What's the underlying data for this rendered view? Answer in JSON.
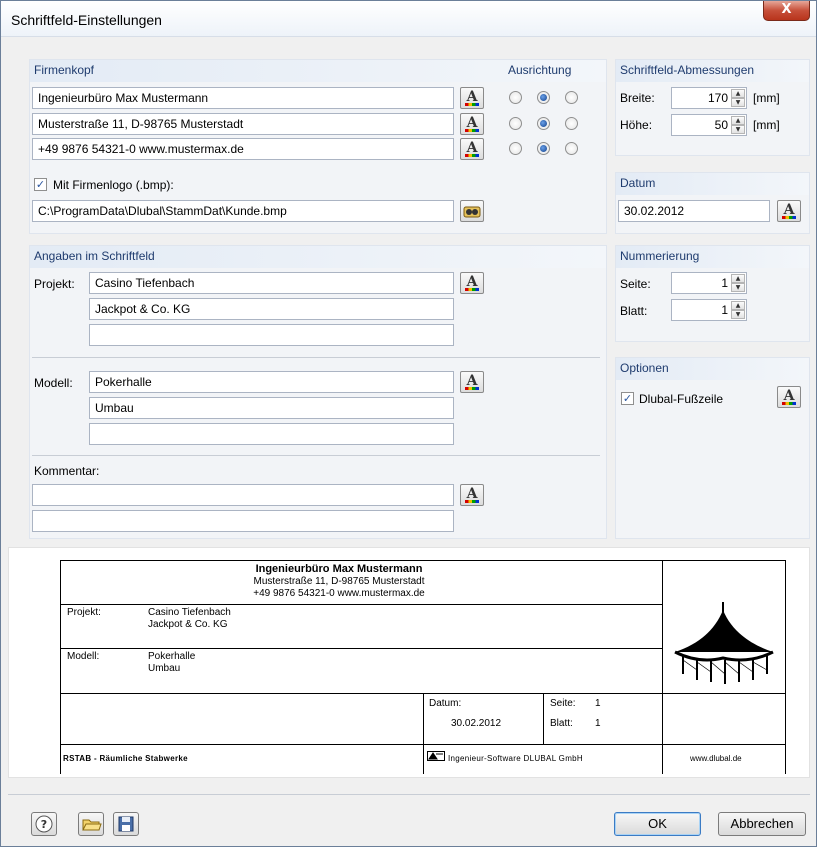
{
  "window": {
    "title": "Schriftfeld-Einstellungen",
    "close_glyph": "X"
  },
  "firmenkopf": {
    "header": "Firmenkopf",
    "ausrichtung_header": "Ausrichtung",
    "lines": [
      "Ingenieurbüro Max Mustermann",
      "Musterstraße 11, D-98765 Musterstadt",
      "+49 9876 54321-0   www.mustermax.de"
    ],
    "alignment_selected": [
      "center",
      "center",
      "center"
    ],
    "logo_checkbox_label": "Mit Firmenlogo (.bmp):",
    "logo_checked": true,
    "logo_path": "C:\\ProgramData\\Dlubal\\StammDat\\Kunde.bmp"
  },
  "abmessungen": {
    "header": "Schriftfeld-Abmessungen",
    "breite_label": "Breite:",
    "breite_value": "170",
    "hoehe_label": "Höhe:",
    "hoehe_value": "50",
    "unit": "[mm]"
  },
  "datum": {
    "header": "Datum",
    "value": "30.02.2012"
  },
  "angaben": {
    "header": "Angaben im Schriftfeld",
    "projekt_label": "Projekt:",
    "projekt_lines": [
      "Casino Tiefenbach",
      "Jackpot & Co. KG",
      ""
    ],
    "modell_label": "Modell:",
    "modell_lines": [
      "Pokerhalle",
      "Umbau",
      ""
    ],
    "kommentar_label": "Kommentar:",
    "kommentar_lines": [
      "",
      ""
    ]
  },
  "nummerierung": {
    "header": "Nummerierung",
    "seite_label": "Seite:",
    "seite_value": "1",
    "blatt_label": "Blatt:",
    "blatt_value": "1"
  },
  "optionen": {
    "header": "Optionen",
    "fusszeile_label": "Dlubal-Fußzeile",
    "fusszeile_checked": true
  },
  "preview": {
    "company": "Ingenieurbüro Max Mustermann",
    "address": "Musterstraße 11, D-98765 Musterstadt",
    "contact": "+49 9876 54321-0   www.mustermax.de",
    "projekt_label": "Projekt:",
    "projekt_1": "Casino Tiefenbach",
    "projekt_2": "Jackpot & Co. KG",
    "modell_label": "Modell:",
    "modell_1": "Pokerhalle",
    "modell_2": "Umbau",
    "datum_label": "Datum:",
    "datum_value": "30.02.2012",
    "seite_label": "Seite:",
    "seite_value": "1",
    "blatt_label": "Blatt:",
    "blatt_value": "1",
    "footer_left": "RSTAB - Räumliche Stabwerke",
    "footer_mid": "Ingenieur-Software DLUBAL GmbH",
    "footer_right": "www.dlubal.de"
  },
  "buttons": {
    "ok": "OK",
    "cancel": "Abbrechen"
  },
  "icons": {
    "font": "font-icon",
    "browse": "browse-folder-icon",
    "help": "help-icon",
    "open": "open-folder-icon",
    "save": "save-icon"
  }
}
